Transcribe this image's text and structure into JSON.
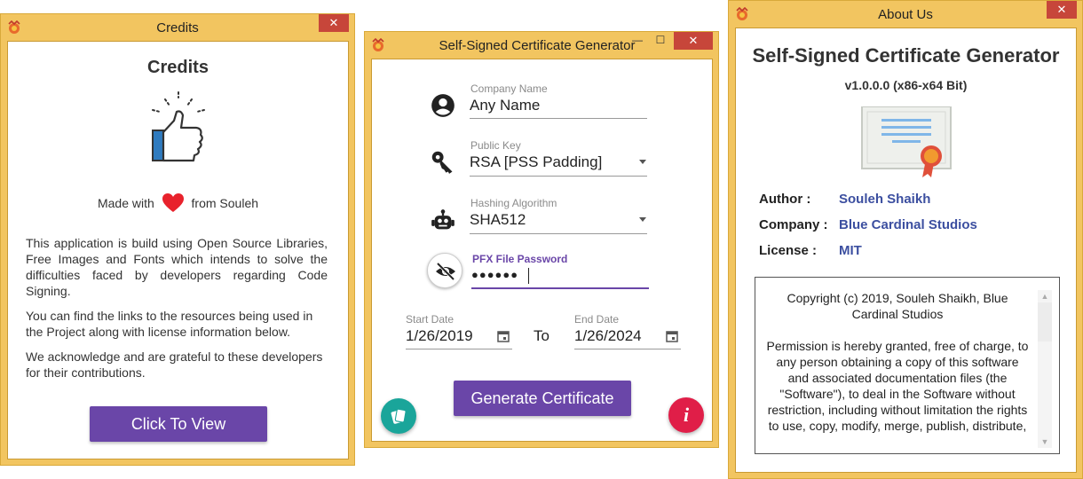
{
  "credits_window": {
    "title": "Credits",
    "close_glyph": "✕",
    "heading": "Credits",
    "made_prefix": "Made with",
    "made_suffix": "from Souleh",
    "paragraph1": "This application is build using Open Source Libraries, Free Images and Fonts which intends to solve the difficulties faced by developers regarding Code Signing.",
    "paragraph2": "You can find the links to the resources being used in the Project along with license information below.",
    "paragraph3": "We acknowledge and are grateful to these developers for their contributions.",
    "view_button": "Click To View",
    "icons": [
      "app-icon",
      "thumbs-up-icon",
      "heart-icon"
    ]
  },
  "generator_window": {
    "title": "Self-Signed Certificate Generator",
    "min_glyph": "—",
    "max_glyph": "☐",
    "close_glyph": "✕",
    "company": {
      "caption": "Company Name",
      "value": "Any Name"
    },
    "public_key": {
      "caption": "Public Key",
      "value": "RSA [PSS Padding]"
    },
    "hashing": {
      "caption": "Hashing Algorithm",
      "value": "SHA512"
    },
    "password": {
      "caption": "PFX File Password",
      "value": "●●●●●●"
    },
    "start_date": {
      "caption": "Start Date",
      "value": "1/26/2019"
    },
    "to_label": "To",
    "end_date": {
      "caption": "End Date",
      "value": "1/26/2024"
    },
    "generate_button": "Generate Certificate",
    "info_glyph": "i",
    "accent_color": "#6a46a8",
    "icons": [
      "user-icon",
      "key-icon",
      "robot-icon",
      "eye-off-icon",
      "calendar-icon",
      "cards-icon",
      "info-icon"
    ]
  },
  "about_window": {
    "title": "About Us",
    "close_glyph": "✕",
    "app_name": "Self-Signed Certificate Generator",
    "version": "v1.0.0.0 (x86-x64 Bit)",
    "author_label": "Author :",
    "author_value": "Souleh Shaikh",
    "company_label": "Company :",
    "company_value": "Blue Cardinal Studios",
    "license_label": "License :",
    "license_value": "MIT",
    "license_text_1": "Copyright (c) 2019, Souleh Shaikh, Blue Cardinal Studios",
    "license_text_2": "Permission is hereby granted, free of charge, to any person obtaining a copy of this software and associated documentation files (the \"Software\"), to deal in the Software without restriction, including without limitation the rights to use, copy, modify, merge, publish, distribute,",
    "value_color": "#3c4fa0",
    "icons": [
      "app-icon",
      "certificate-icon"
    ]
  }
}
